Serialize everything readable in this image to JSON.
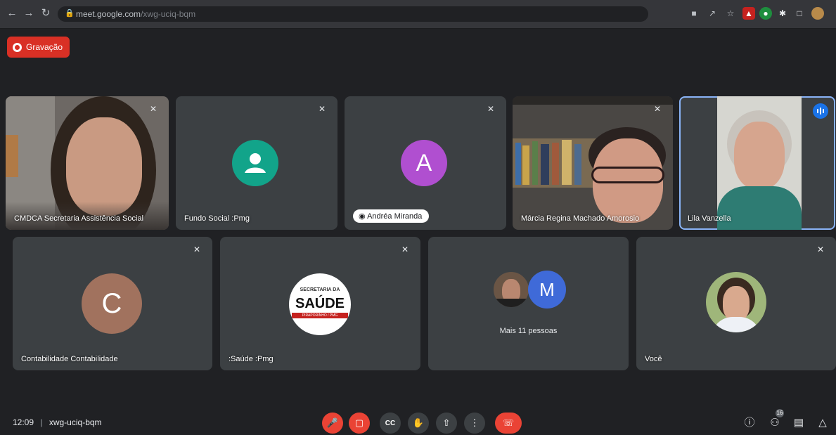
{
  "browser": {
    "url_host": "meet.google.com",
    "url_path": "/xwg-uciq-bqm",
    "back_icon": "arrow-left-icon",
    "forward_icon": "arrow-right-icon",
    "reload_icon": "reload-icon"
  },
  "recording": {
    "label": "Gravação",
    "color": "#d93025"
  },
  "participants_top": [
    {
      "name": "CMDCA  Secretaria Assistência Social",
      "type": "video",
      "mic": "muted"
    },
    {
      "name": "Fundo Social :Pmg",
      "type": "avatar-generic",
      "avatar_color": "#12a48a",
      "mic": "muted"
    },
    {
      "name": "Andréa Miranda",
      "type": "avatar-letter",
      "letter": "A",
      "avatar_color": "#b04fd0",
      "mic": "muted"
    },
    {
      "name": "Márcia Regina Machado Amorosio",
      "type": "video",
      "mic": "muted"
    },
    {
      "name": "Lila Vanzella",
      "type": "video",
      "mic": "speaking",
      "active": true
    }
  ],
  "participants_bottom": [
    {
      "name": "Contabilidade Contabilidade",
      "type": "avatar-letter",
      "letter": "C",
      "avatar_color": "#a1725e",
      "mic": "muted"
    },
    {
      "name": ":Saúde :Pmg",
      "type": "logo",
      "logo_top": "SECRETARIA DA",
      "logo_main": "SAÚDE",
      "logo_bottom": "PIRAPORINHO / PMG",
      "mic": "muted"
    },
    {
      "name": "Mais 11 pessoas",
      "type": "group",
      "letter": "M",
      "avatar_color": "#3f6ad8"
    },
    {
      "name": "Você",
      "type": "video-round",
      "mic": "muted"
    }
  ],
  "bottom_bar": {
    "time": "12:09",
    "meeting_code": "xwg-uciq-bqm",
    "people_count": "16",
    "controls": [
      {
        "name": "mic-off-button",
        "icon": "mic-off-icon",
        "color": "#ea4335"
      },
      {
        "name": "camera-off-button",
        "icon": "video-off-icon",
        "color": "#ea4335"
      },
      {
        "name": "captions-button",
        "icon": "captions-icon"
      },
      {
        "name": "raise-hand-button",
        "icon": "hand-icon"
      },
      {
        "name": "present-button",
        "icon": "present-icon"
      },
      {
        "name": "more-options-button",
        "icon": "more-vert-icon"
      },
      {
        "name": "leave-call-button",
        "icon": "call-end-icon",
        "color": "#ea4335"
      }
    ],
    "right_icons": [
      "info-icon",
      "people-icon",
      "chat-icon",
      "activities-icon"
    ]
  }
}
